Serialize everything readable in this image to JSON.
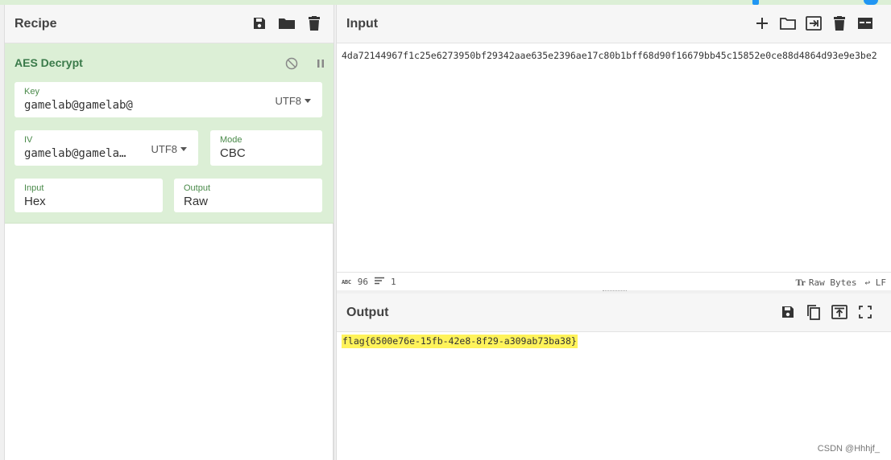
{
  "recipe": {
    "title": "Recipe",
    "icons": [
      "save-icon",
      "folder-icon",
      "trash-icon"
    ]
  },
  "operation": {
    "name": "AES Decrypt",
    "key": {
      "label": "Key",
      "value": "gamelab@gamelab@",
      "encoding": "UTF8"
    },
    "iv": {
      "label": "IV",
      "value": "gamelab@gamela…",
      "encoding": "UTF8"
    },
    "mode": {
      "label": "Mode",
      "value": "CBC"
    },
    "input_format": {
      "label": "Input",
      "value": "Hex"
    },
    "output_format": {
      "label": "Output",
      "value": "Raw"
    }
  },
  "input": {
    "title": "Input",
    "text": "4da72144967f1c25e6273950bf29342aae635e2396ae17c80b1bff68d90f16679bb45c15852e0ce88d4864d93e9e3be2",
    "status": {
      "chars_icon": "ABC",
      "chars": "96",
      "lines": "1",
      "format_icon": "Tr",
      "format": "Raw Bytes",
      "eol": "LF"
    }
  },
  "output": {
    "title": "Output",
    "text": "flag{6500e76e-15fb-42e8-8f29-a309ab73ba38}"
  },
  "watermark": "CSDN @Hhhjf_",
  "colors": {
    "accent": "#dcefd6",
    "highlight": "#fff35a",
    "label": "#4a8a4a"
  }
}
